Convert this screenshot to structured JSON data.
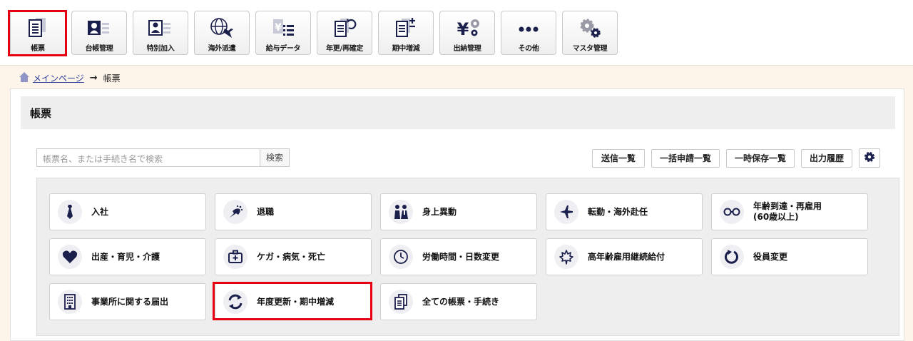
{
  "toolbar": {
    "buttons": [
      {
        "label": "帳票",
        "icon": "document-stack-icon"
      },
      {
        "label": "台帳管理",
        "icon": "id-card-icon"
      },
      {
        "label": "特別加入",
        "icon": "id-card-plus-icon"
      },
      {
        "label": "海外派遣",
        "icon": "globe-plane-icon"
      },
      {
        "label": "給与データ",
        "icon": "yen-list-icon"
      },
      {
        "label": "年更/再確定",
        "icon": "document-refresh-icon"
      },
      {
        "label": "期中増減",
        "icon": "document-plus-minus-icon"
      },
      {
        "label": "出納管理",
        "icon": "yen-gear-icon"
      },
      {
        "label": "その他",
        "icon": "more-dots-icon"
      },
      {
        "label": "マスタ管理",
        "icon": "gears-icon"
      }
    ]
  },
  "breadcrumb": {
    "home_label": "メインページ",
    "current": "帳票"
  },
  "page": {
    "title": "帳票",
    "search_placeholder": "帳票名、または手続き名で検索",
    "search_button": "検索",
    "actions": [
      "送信一覧",
      "一括申請一覧",
      "一時保存一覧",
      "出力履歴"
    ]
  },
  "tiles": [
    {
      "label": "入社",
      "icon": "necktie-icon"
    },
    {
      "label": "退職",
      "icon": "bouquet-icon"
    },
    {
      "label": "身上異動",
      "icon": "couple-icon"
    },
    {
      "label": "転勤・海外赴任",
      "icon": "airplane-icon"
    },
    {
      "label": "年齢到達・再雇用\n(60歳以上)",
      "icon": "glasses-icon"
    },
    {
      "label": "出産・育児・介護",
      "icon": "heart-icon"
    },
    {
      "label": "ケガ・病気・死亡",
      "icon": "medical-kit-icon"
    },
    {
      "label": "労働時間・日数変更",
      "icon": "clock-icon"
    },
    {
      "label": "高年齢雇用継続給付",
      "icon": "maple-leaf-icon"
    },
    {
      "label": "役員変更",
      "icon": "circular-arrow-icon"
    },
    {
      "label": "事業所に関する届出",
      "icon": "building-icon"
    },
    {
      "label": "年度更新・期中増減",
      "icon": "refresh-arrows-icon"
    },
    {
      "label": "全ての帳票・手続き",
      "icon": "documents-icon"
    }
  ],
  "colors": {
    "icon_navy": "#1b1f4b",
    "highlight_red": "#e60012",
    "page_background": "#fdf5ea"
  }
}
